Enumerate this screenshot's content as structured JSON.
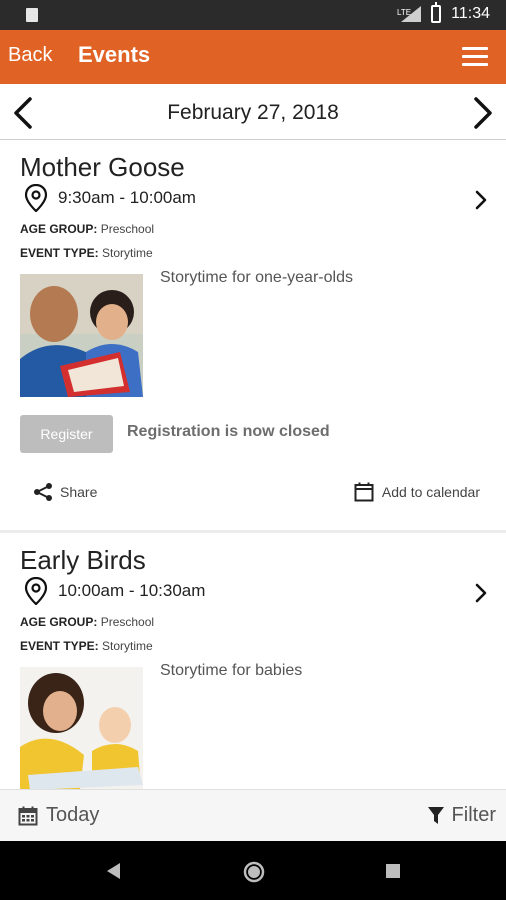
{
  "status_bar": {
    "time": "11:34",
    "network": "LTE"
  },
  "header": {
    "back_label": "Back",
    "title": "Events"
  },
  "date_bar": {
    "date": "February 27, 2018"
  },
  "events": [
    {
      "title": "Mother Goose",
      "time": "9:30am - 10:00am",
      "age_group_label": "AGE GROUP:",
      "age_group": "Preschool",
      "event_type_label": "EVENT TYPE:",
      "event_type": "Storytime",
      "description": "Storytime for one-year-olds",
      "register_label": "Register",
      "registration_status": "Registration is now closed",
      "share_label": "Share",
      "add_calendar_label": "Add to calendar"
    },
    {
      "title": "Early Birds",
      "time": "10:00am - 10:30am",
      "age_group_label": "AGE GROUP:",
      "age_group": "Preschool",
      "event_type_label": "EVENT TYPE:",
      "event_type": "Storytime",
      "description": "Storytime for babies"
    }
  ],
  "bottom_bar": {
    "today_label": "Today",
    "filter_label": "Filter"
  },
  "colors": {
    "header": "#e06325",
    "register_disabled": "#bdbdbd"
  }
}
